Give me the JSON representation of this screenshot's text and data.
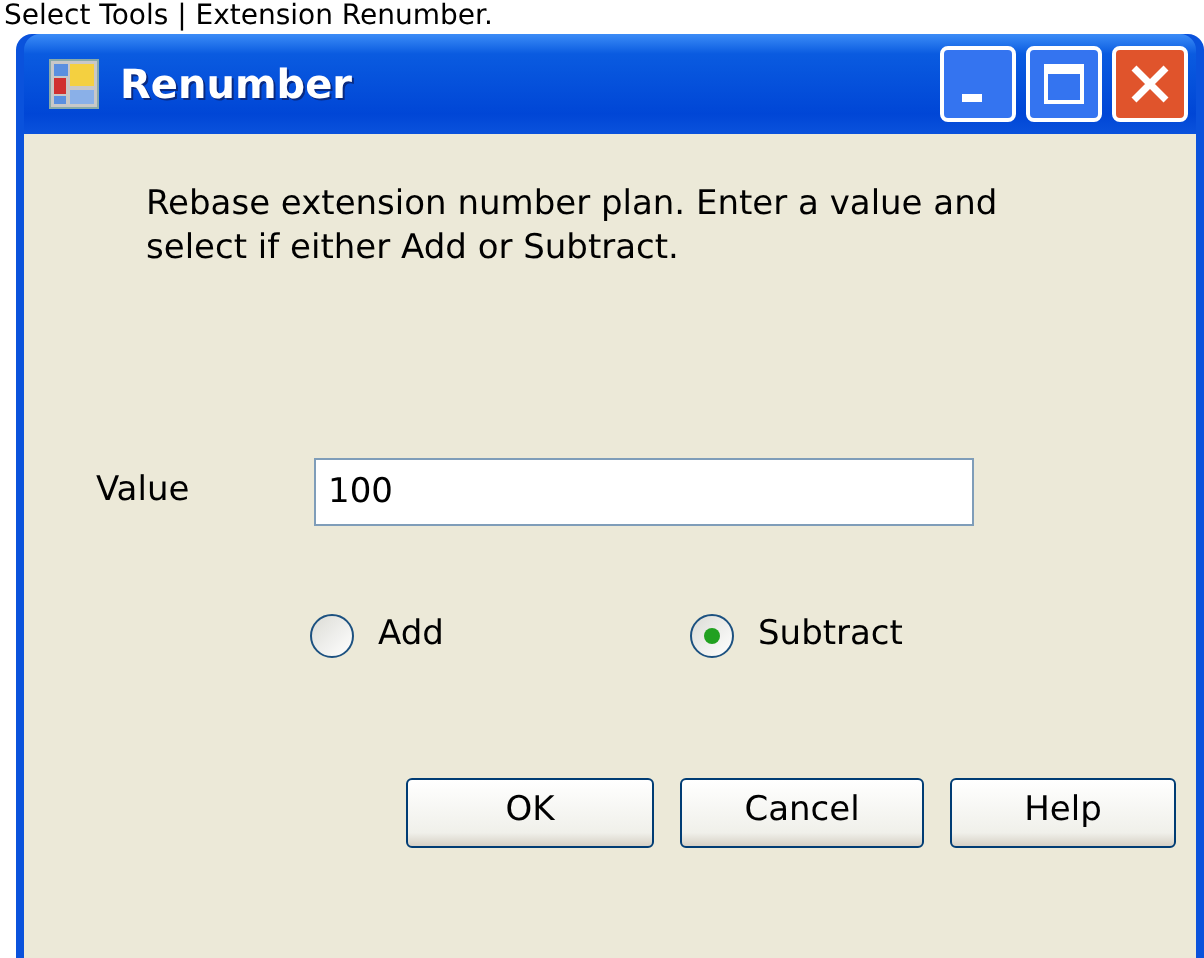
{
  "caption": "Select Tools | Extension Renumber.",
  "window": {
    "title": "Renumber"
  },
  "description": "Rebase extension number plan. Enter a value and select if either Add or Subtract.",
  "value_field": {
    "label": "Value",
    "value": "100"
  },
  "options": [
    {
      "label": "Add",
      "selected": false
    },
    {
      "label": "Subtract",
      "selected": true
    }
  ],
  "buttons": [
    "OK",
    "Cancel",
    "Help"
  ]
}
